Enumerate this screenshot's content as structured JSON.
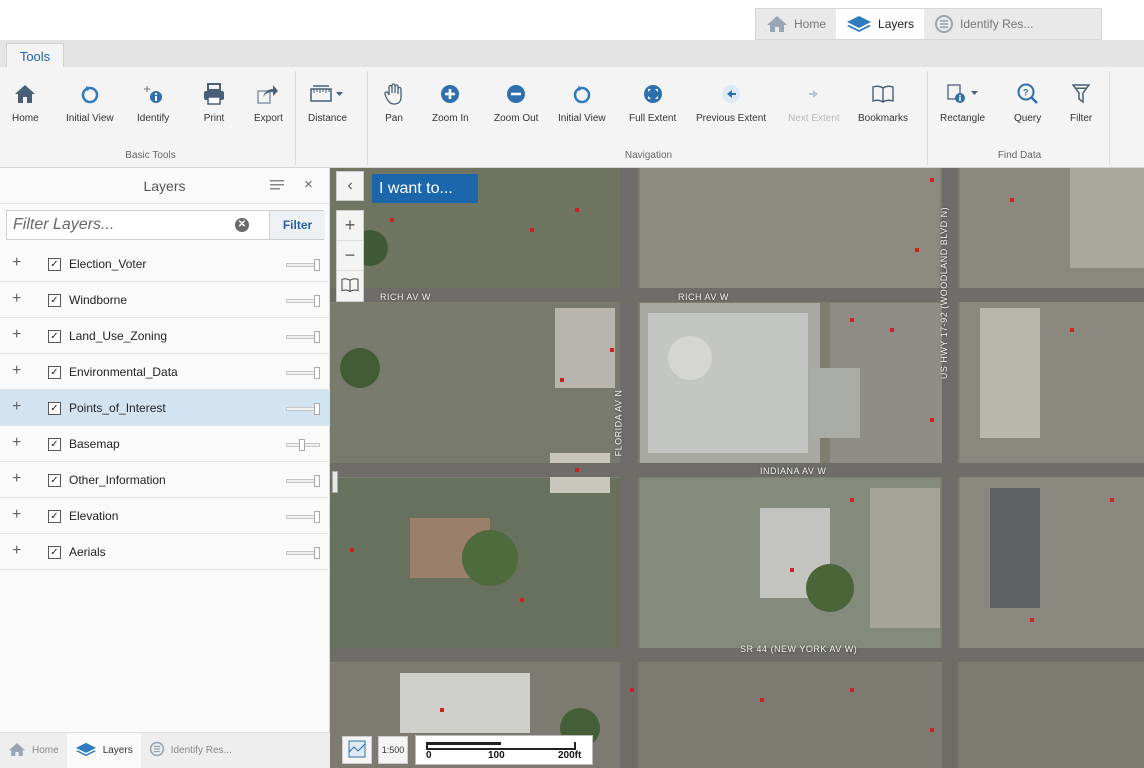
{
  "top_tabs": [
    {
      "label": "Home",
      "icon": "home-icon"
    },
    {
      "label": "Layers",
      "icon": "layers-icon"
    },
    {
      "label": "Identify Res...",
      "icon": "identify-results-icon"
    }
  ],
  "ribbon": {
    "tab_label": "Tools",
    "basic_tools": {
      "label": "Basic Tools",
      "items": [
        "Home",
        "Initial View",
        "Identify",
        "Print",
        "Export"
      ]
    },
    "distance": {
      "label": "Distance"
    },
    "navigation": {
      "label": "Navigation",
      "items": [
        "Pan",
        "Zoom In",
        "Zoom Out",
        "Initial View",
        "Full Extent",
        "Previous Extent",
        "Next Extent",
        "Bookmarks"
      ]
    },
    "find_data": {
      "label": "Find Data",
      "items": [
        "Rectangle",
        "Query",
        "Filter"
      ]
    }
  },
  "layers_panel": {
    "title": "Layers",
    "close_glyph": "×",
    "filter_placeholder": "Filter Layers...",
    "filter_button": "Filter",
    "layers": [
      {
        "name": "Election_Voter",
        "checked": true,
        "opacity": 1.0,
        "selected": false
      },
      {
        "name": "Windborne",
        "checked": true,
        "opacity": 1.0,
        "selected": false
      },
      {
        "name": "Land_Use_Zoning",
        "checked": true,
        "opacity": 1.0,
        "selected": false
      },
      {
        "name": "Environmental_Data",
        "checked": true,
        "opacity": 1.0,
        "selected": false
      },
      {
        "name": "Points_of_Interest",
        "checked": true,
        "opacity": 1.0,
        "selected": true
      },
      {
        "name": "Basemap",
        "checked": true,
        "opacity": 0.45,
        "selected": false
      },
      {
        "name": "Other_Information",
        "checked": true,
        "opacity": 1.0,
        "selected": false
      },
      {
        "name": "Elevation",
        "checked": true,
        "opacity": 1.0,
        "selected": false
      },
      {
        "name": "Aerials",
        "checked": true,
        "opacity": 1.0,
        "selected": false
      }
    ],
    "footer_tabs": [
      "Home",
      "Layers",
      "Identify Res..."
    ]
  },
  "map": {
    "iwant_label": "I want to...",
    "collapse_glyph": "‹",
    "zoom_in_glyph": "+",
    "zoom_out_glyph": "−",
    "scale_labels": [
      "0",
      "100",
      "200ft"
    ],
    "scale_button": "1:500",
    "streets": [
      "RICH AV W",
      "RICH AV W",
      "INDIANA AV W",
      "SR 44 (NEW YORK AV W)",
      "FLORIDA AV N",
      "US HWY 17-92 (WOODLAND BLVD N)"
    ]
  }
}
